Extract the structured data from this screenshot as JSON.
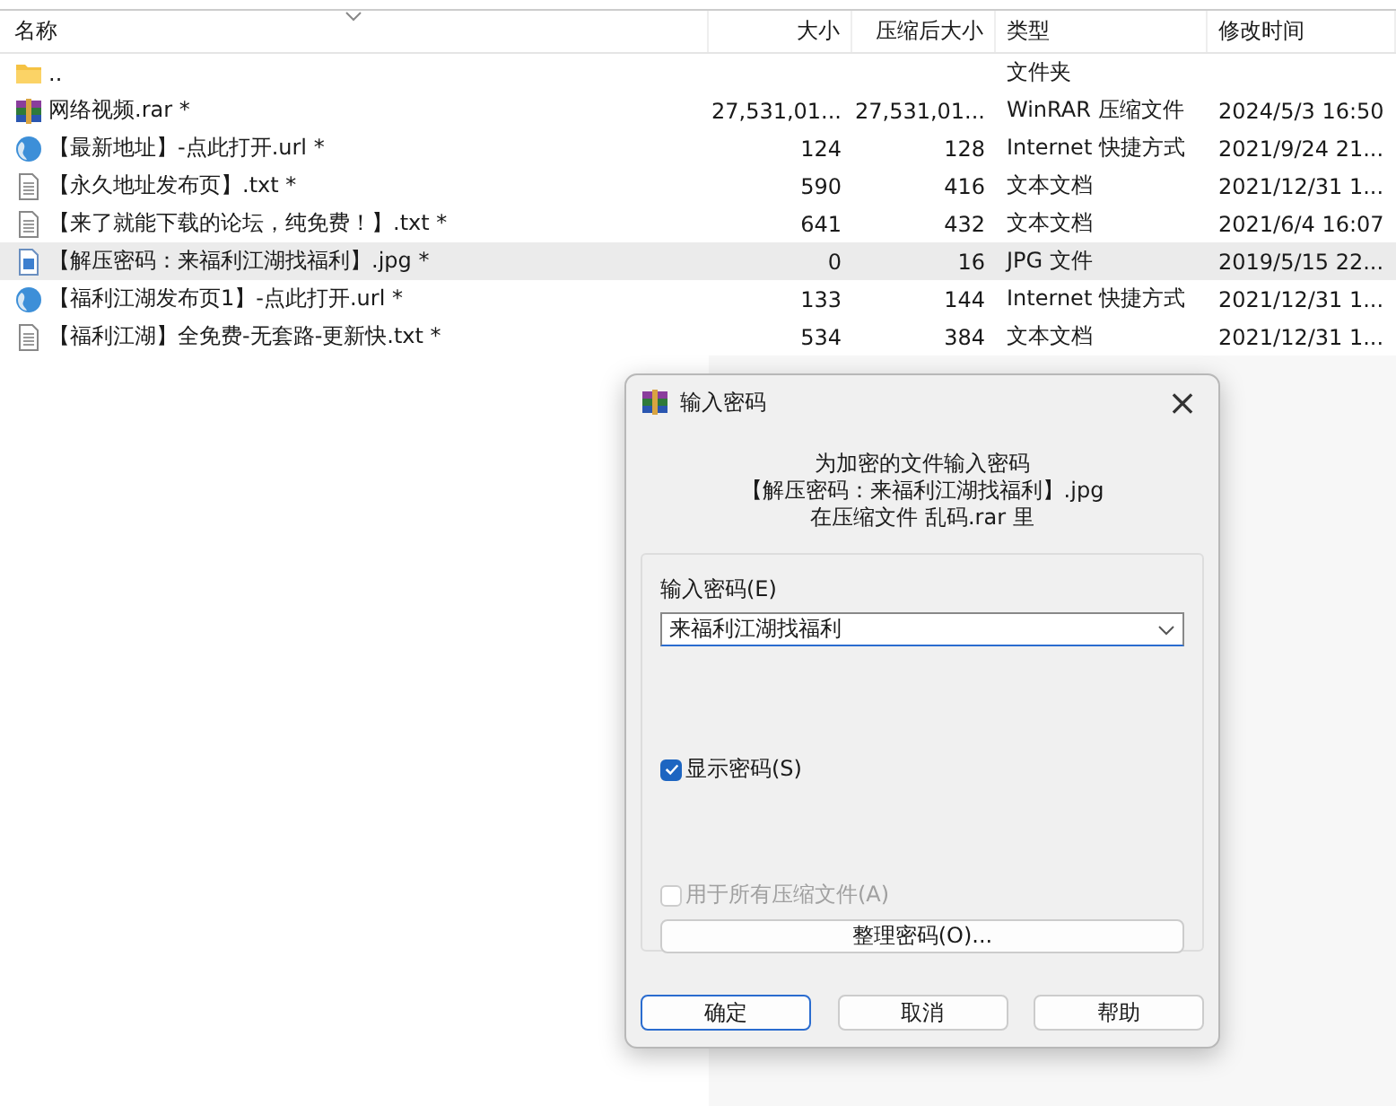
{
  "table": {
    "columns": [
      {
        "label": "名称",
        "sorted": true
      },
      {
        "label": "大小",
        "sorted": false
      },
      {
        "label": "压缩后大小",
        "sorted": false
      },
      {
        "label": "类型",
        "sorted": false
      },
      {
        "label": "修改时间",
        "sorted": false
      }
    ],
    "rows": [
      {
        "kind": "folder",
        "name": "..",
        "size": "",
        "packed": "",
        "type": "文件夹",
        "modified": "",
        "selected": false
      },
      {
        "kind": "rar",
        "name": "网络视频.rar *",
        "size": "27,531,01...",
        "packed": "27,531,01...",
        "type": "WinRAR 压缩文件",
        "modified": "2024/5/3 16:50",
        "selected": false
      },
      {
        "kind": "url",
        "name": "【最新地址】-点此打开.url *",
        "size": "124",
        "packed": "128",
        "type": "Internet 快捷方式",
        "modified": "2021/9/24 21...",
        "selected": false
      },
      {
        "kind": "txt",
        "name": "【永久地址发布页】.txt *",
        "size": "590",
        "packed": "416",
        "type": "文本文档",
        "modified": "2021/12/31 1...",
        "selected": false
      },
      {
        "kind": "txt",
        "name": "【来了就能下载的论坛，纯免费！】.txt *",
        "size": "641",
        "packed": "432",
        "type": "文本文档",
        "modified": "2021/6/4 16:07",
        "selected": false
      },
      {
        "kind": "jpg",
        "name": "【解压密码：来福利江湖找福利】.jpg *",
        "size": "0",
        "packed": "16",
        "type": "JPG 文件",
        "modified": "2019/5/15 22...",
        "selected": true
      },
      {
        "kind": "url",
        "name": "【福利江湖发布页1】-点此打开.url *",
        "size": "133",
        "packed": "144",
        "type": "Internet 快捷方式",
        "modified": "2021/12/31 1...",
        "selected": false
      },
      {
        "kind": "txt",
        "name": "【福利江湖】全免费-无套路-更新快.txt *",
        "size": "534",
        "packed": "384",
        "type": "文本文档",
        "modified": "2021/12/31 1...",
        "selected": false
      }
    ]
  },
  "dialog": {
    "title": "输入密码",
    "close": "×",
    "message": [
      "为加密的文件输入密码",
      "【解压密码：来福利江湖找福利】.jpg",
      "在压缩文件 乱码.rar 里"
    ],
    "password_label": "输入密码(E)",
    "password": "来福利江湖找福利",
    "show_password": {
      "label": "显示密码(S)",
      "checked": true,
      "disabled": false
    },
    "use_for_all": {
      "label": "用于所有压缩文件(A)",
      "checked": false,
      "disabled": true
    },
    "organize_button": "整理密码(O)...",
    "buttons": [
      {
        "label": "确定",
        "default": true
      },
      {
        "label": "取消",
        "default": false
      },
      {
        "label": "帮助",
        "default": false
      }
    ]
  }
}
